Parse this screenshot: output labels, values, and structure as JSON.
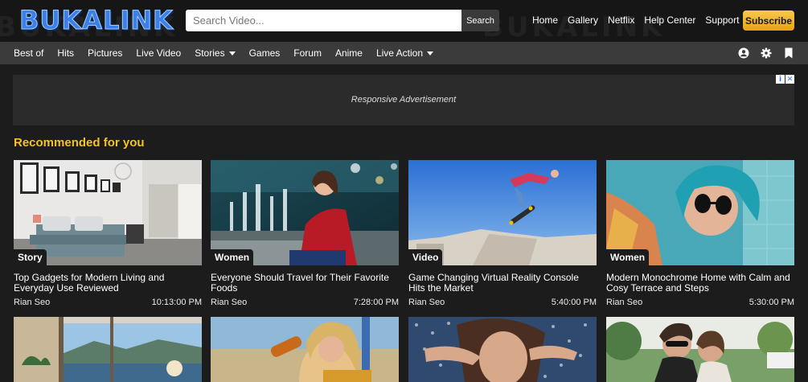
{
  "header": {
    "logo": "BUKALINK",
    "search_placeholder": "Search Video...",
    "search_button": "Search",
    "links": [
      "Home",
      "Gallery",
      "Netflix",
      "Help Center",
      "Support"
    ],
    "subscribe": "Subscribe"
  },
  "nav": {
    "items": [
      {
        "label": "Best of",
        "dropdown": false
      },
      {
        "label": "Hits",
        "dropdown": false
      },
      {
        "label": "Pictures",
        "dropdown": false
      },
      {
        "label": "Live Video",
        "dropdown": false
      },
      {
        "label": "Stories",
        "dropdown": true
      },
      {
        "label": "Games",
        "dropdown": false
      },
      {
        "label": "Forum",
        "dropdown": false
      },
      {
        "label": "Anime",
        "dropdown": false
      },
      {
        "label": "Live Action",
        "dropdown": true
      }
    ],
    "icons": [
      "user-icon",
      "gear-icon",
      "bookmark-icon"
    ]
  },
  "ad": {
    "text": "Responsive Advertisement"
  },
  "section_title": "Recommended for you",
  "cards": [
    {
      "badge": "Story",
      "title": "Top Gadgets for Modern Living and Everyday Use Reviewed",
      "author": "Rian Seo",
      "time": "10:13:00 PM"
    },
    {
      "badge": "Women",
      "title": "Everyone Should Travel for Their Favorite Foods",
      "author": "Rian Seo",
      "time": "7:28:00 PM"
    },
    {
      "badge": "Video",
      "title": "Game Changing Virtual Reality Console Hits the Market",
      "author": "Rian Seo",
      "time": "5:40:00 PM"
    },
    {
      "badge": "Women",
      "title": "Modern Monochrome Home with Calm and Cosy Terrace and Steps",
      "author": "Rian Seo",
      "time": "5:30:00 PM"
    }
  ],
  "colors": {
    "accent": "#f4c227",
    "nav_bg": "#3b3b3b",
    "page_bg": "#1c1c1c"
  }
}
